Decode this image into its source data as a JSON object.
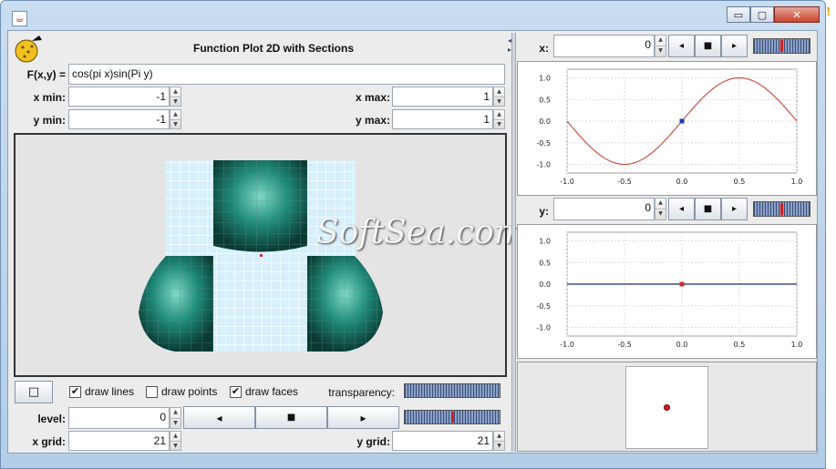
{
  "window": {
    "min_glyph": "▭",
    "max_glyph": "▢",
    "close_glyph": "✕",
    "app_icon_glyph": "☕",
    "warning_glyph": "!"
  },
  "left": {
    "title": "Function Plot 2D with Sections",
    "fxy_label": "F(x,y) =",
    "fxy_value": "cos(pi x)sin(Pi y)",
    "xmin_label": "x min:",
    "xmin_value": "-1",
    "xmax_label": "x max:",
    "xmax_value": "1",
    "ymin_label": "y min:",
    "ymin_value": "-1",
    "ymax_label": "y max:",
    "ymax_value": "1",
    "square_button": "□",
    "draw_lines_label": "draw lines",
    "draw_lines_checked": true,
    "draw_points_label": "draw points",
    "draw_points_checked": false,
    "draw_faces_label": "draw faces",
    "draw_faces_checked": true,
    "transparency_label": "transparency:",
    "transparency_level": 0.0,
    "level_label": "level:",
    "level_value": "0",
    "level_slider": 0.5,
    "prev_glyph": "◂",
    "stop_glyph": "■",
    "next_glyph": "▸",
    "xgrid_label": "x grid:",
    "xgrid_value": "21",
    "ygrid_label": "y grid:",
    "ygrid_value": "21"
  },
  "right": {
    "x_label": "x:",
    "x_value": "0",
    "x_slider": 0.5,
    "y_label": "y:",
    "y_value": "0",
    "y_slider": 0.5
  },
  "charts": {
    "ticks_x": [
      "-1.0",
      "-0.5",
      "0.0",
      "0.5",
      "1.0"
    ],
    "ticks_y": [
      "1.0",
      "0.5",
      "0.0",
      "-0.5",
      "-1.0"
    ]
  },
  "chart_data": [
    {
      "type": "line",
      "x_range": [
        -1,
        1
      ],
      "ylim": [
        -1.2,
        1.2
      ],
      "series": [
        {
          "function": "sin(pi x)",
          "color": "#c8554a",
          "marker": {
            "x": 0,
            "y": 0,
            "color": "#1f3fb0"
          }
        }
      ]
    },
    {
      "type": "line",
      "x_range": [
        -1,
        1
      ],
      "ylim": [
        -1.2,
        1.2
      ],
      "series": [
        {
          "function": "0",
          "color": "#1a2a66",
          "marker": {
            "x": 0,
            "y": 0,
            "color": "#c83030"
          }
        }
      ]
    }
  ],
  "watermark": "SoftSea.com"
}
